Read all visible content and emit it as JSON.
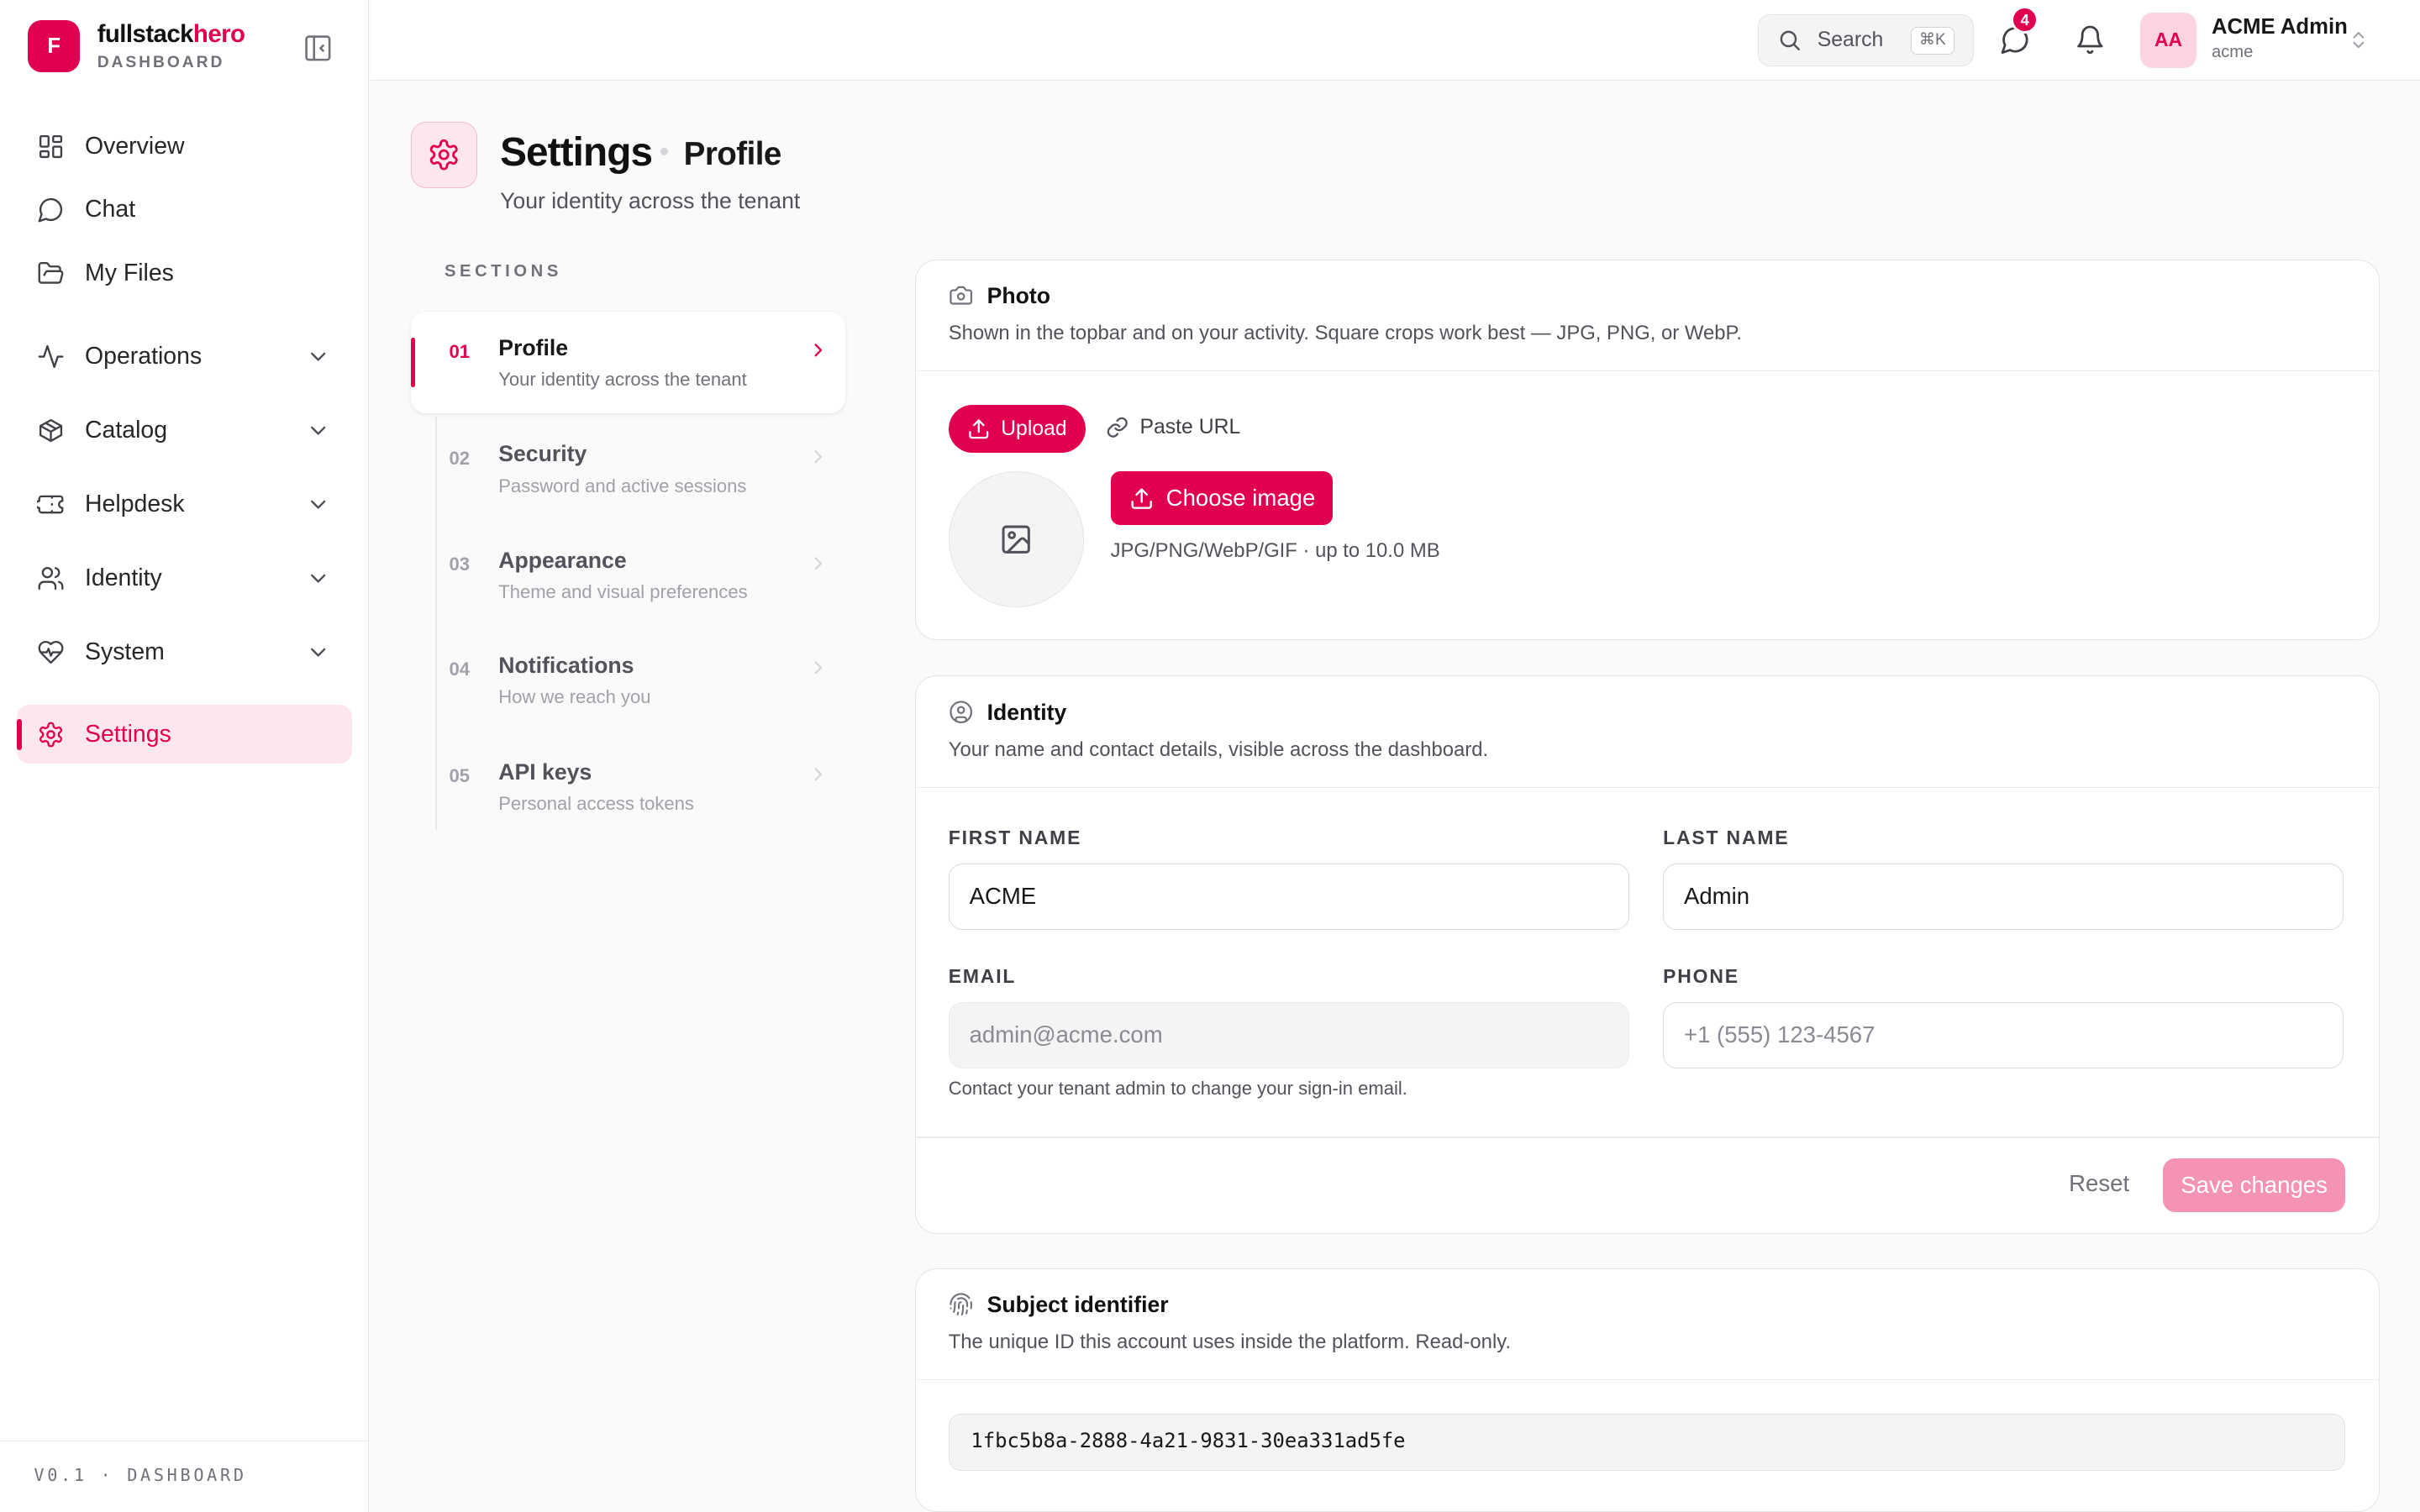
{
  "brand": {
    "logo_letter": "F",
    "name_part1": "fullstack",
    "name_part2": "hero",
    "subtitle": "DASHBOARD",
    "accent_color": "#e0004f"
  },
  "sidebar": {
    "items": [
      {
        "label": "Overview"
      },
      {
        "label": "Chat"
      },
      {
        "label": "My Files"
      },
      {
        "label": "Operations"
      },
      {
        "label": "Catalog"
      },
      {
        "label": "Helpdesk"
      },
      {
        "label": "Identity"
      },
      {
        "label": "System"
      },
      {
        "label": "Settings"
      }
    ],
    "footer": "V0.1 · DASHBOARD"
  },
  "topbar": {
    "search_label": "Search",
    "search_shortcut": "⌘K",
    "messages_badge": "4",
    "user_initials": "AA",
    "user_name": "ACME Admin",
    "user_tenant": "acme"
  },
  "page": {
    "title": "Settings",
    "crumb": "Profile",
    "subtitle": "Your identity across the tenant"
  },
  "sections": {
    "label": "SECTIONS",
    "items": [
      {
        "num": "01",
        "title": "Profile",
        "desc": "Your identity across the tenant"
      },
      {
        "num": "02",
        "title": "Security",
        "desc": "Password and active sessions"
      },
      {
        "num": "03",
        "title": "Appearance",
        "desc": "Theme and visual preferences"
      },
      {
        "num": "04",
        "title": "Notifications",
        "desc": "How we reach you"
      },
      {
        "num": "05",
        "title": "API keys",
        "desc": "Personal access tokens"
      }
    ]
  },
  "photo": {
    "title": "Photo",
    "desc": "Shown in the topbar and on your activity. Square crops work best — JPG, PNG, or WebP.",
    "upload_label": "Upload",
    "paste_label": "Paste URL",
    "choose_label": "Choose image",
    "hint": "JPG/PNG/WebP/GIF · up to 10.0 MB"
  },
  "identity": {
    "title": "Identity",
    "desc": "Your name and contact details, visible across the dashboard.",
    "first_name_label": "FIRST NAME",
    "first_name_value": "ACME",
    "last_name_label": "LAST NAME",
    "last_name_value": "Admin",
    "email_label": "EMAIL",
    "email_placeholder": "admin@acme.com",
    "email_help": "Contact your tenant admin to change your sign-in email.",
    "phone_label": "PHONE",
    "phone_placeholder": "+1 (555) 123-4567",
    "reset_label": "Reset",
    "save_label": "Save changes"
  },
  "subject": {
    "title": "Subject identifier",
    "desc": "The unique ID this account uses inside the platform. Read-only.",
    "value": "1fbc5b8a-2888-4a21-9831-30ea331ad5fe"
  }
}
